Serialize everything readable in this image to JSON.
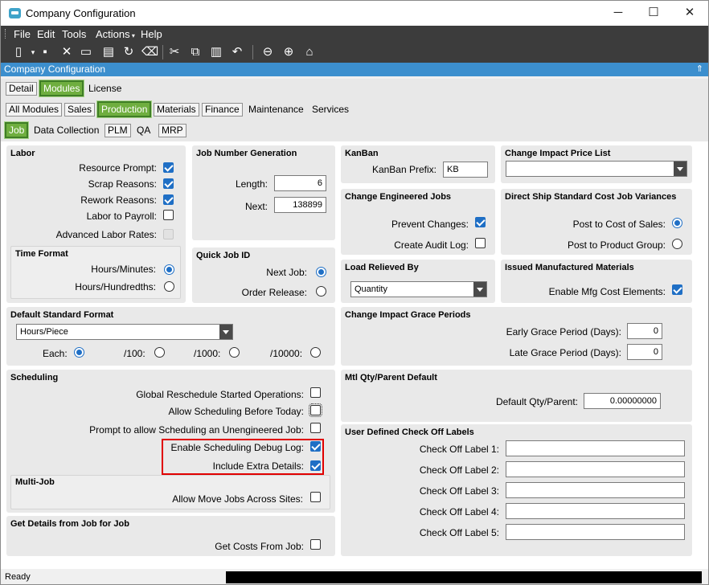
{
  "window": {
    "title": "Company Configuration",
    "minimize": "─",
    "maximize": "☐",
    "close": "✕"
  },
  "menu": [
    "File",
    "Edit",
    "Tools",
    "Actions",
    "Help"
  ],
  "company_bar": {
    "label": "Company Configuration",
    "pin": "⇑"
  },
  "tabs_top": [
    "Detail",
    "Modules",
    "License"
  ],
  "tabs_modules": [
    "All Modules",
    "Sales",
    "Production",
    "Materials",
    "Finance",
    "Maintenance",
    "Services"
  ],
  "tabs_production": [
    "Job",
    "Data Collection",
    "PLM",
    "QA",
    "MRP"
  ],
  "labor": {
    "title": "Labor",
    "resource_prompt": "Resource Prompt:",
    "resource_prompt_checked": true,
    "scrap_reasons": "Scrap Reasons:",
    "scrap_reasons_checked": true,
    "rework_reasons": "Rework Reasons:",
    "rework_reasons_checked": true,
    "labor_to_payroll": "Labor to Payroll:",
    "labor_to_payroll_checked": false,
    "advanced_labor_rates": "Advanced Labor Rates:",
    "advanced_labor_rates_checked": false
  },
  "time_format": {
    "title": "Time Format",
    "hours_minutes": "Hours/Minutes:",
    "hours_hundredths": "Hours/Hundredths:",
    "selected": "Hours/Minutes"
  },
  "job_number_generation": {
    "title": "Job Number Generation",
    "length_label": "Length:",
    "length_value": "6",
    "next_label": "Next:",
    "next_value": "138899"
  },
  "quick_job_id": {
    "title": "Quick Job ID",
    "next_job": "Next Job:",
    "order_release": "Order Release:",
    "selected": "Next Job"
  },
  "kanban": {
    "title": "KanBan",
    "prefix_label": "KanBan Prefix:",
    "prefix_value": "KB"
  },
  "change_impact_price_list": {
    "title": "Change Impact Price List",
    "value": ""
  },
  "change_engineered_jobs": {
    "title": "Change Engineered Jobs",
    "prevent_changes": "Prevent Changes:",
    "prevent_changes_checked": true,
    "create_audit_log": "Create Audit Log:",
    "create_audit_log_checked": false
  },
  "direct_ship": {
    "title": "Direct Ship Standard Cost Job Variances",
    "post_to_cost_of_sales": "Post to Cost of Sales:",
    "post_to_product_group": "Post to Product Group:",
    "selected": "Post to Cost of Sales"
  },
  "load_relieved_by": {
    "title": "Load Relieved By",
    "value": "Quantity"
  },
  "issued_manufactured_materials": {
    "title": "Issued Manufactured Materials",
    "enable_mfg_cost": "Enable Mfg Cost Elements:",
    "enable_mfg_cost_checked": true
  },
  "default_standard_format": {
    "title": "Default Standard Format",
    "value": "Hours/Piece",
    "each": "Each:",
    "per100": "/100:",
    "per1000": "/1000:",
    "per10000": "/10000:",
    "selected": "Each"
  },
  "change_impact_grace_periods": {
    "title": "Change Impact Grace Periods",
    "early_label": "Early Grace Period (Days):",
    "early_value": "0",
    "late_label": "Late Grace Period (Days):",
    "late_value": "0"
  },
  "scheduling": {
    "title": "Scheduling",
    "global_reschedule": "Global Reschedule Started Operations:",
    "global_reschedule_checked": false,
    "allow_before_today": "Allow Scheduling Before Today:",
    "allow_before_today_checked": false,
    "prompt_unengineered": "Prompt to allow Scheduling an Unengineered Job:",
    "prompt_unengineered_checked": false,
    "enable_debug_log": "Enable Scheduling Debug Log:",
    "enable_debug_log_checked": true,
    "include_extra_details": "Include Extra Details:",
    "include_extra_details_checked": true
  },
  "multi_job": {
    "title": "Multi-Job",
    "allow_move": "Allow Move Jobs Across Sites:",
    "allow_move_checked": false
  },
  "get_details": {
    "title": "Get Details from Job for Job",
    "get_costs": "Get Costs From Job:",
    "get_costs_checked": false
  },
  "mtl_qty_parent": {
    "title": "Mtl Qty/Parent Default",
    "label": "Default Qty/Parent:",
    "value": "0.00000000"
  },
  "user_defined_checkoff": {
    "title": "User Defined Check Off Labels",
    "labels": [
      "Check Off Label 1:",
      "Check Off Label 2:",
      "Check Off Label 3:",
      "Check Off Label 4:",
      "Check Off Label 5:"
    ],
    "values": [
      "",
      "",
      "",
      "",
      ""
    ]
  },
  "status": {
    "text": "Ready"
  },
  "colors": {
    "active_tab": "#6fae3f",
    "company_bar": "#3c8fce",
    "checkbox_on": "#1f6fc5",
    "highlight": "#e00000",
    "toolbar": "#3c3c3c"
  }
}
